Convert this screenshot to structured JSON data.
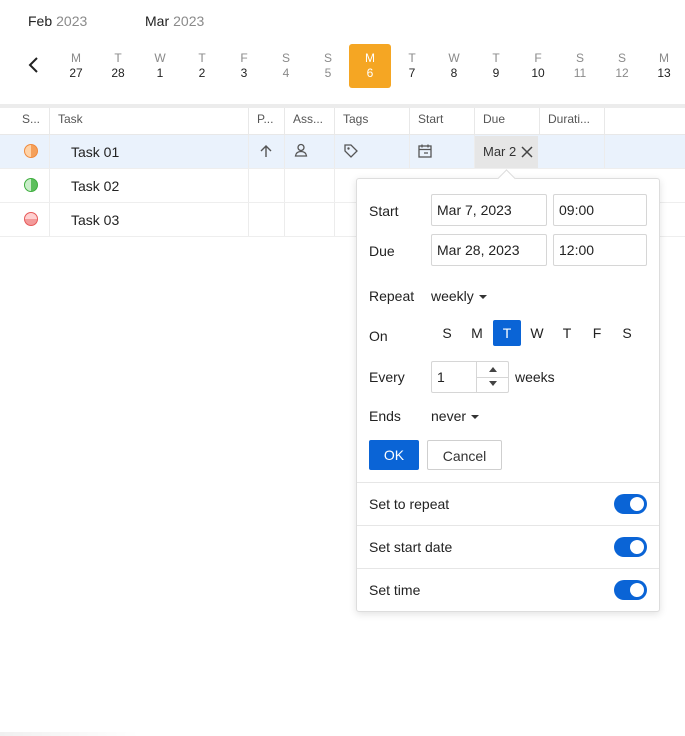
{
  "calendar": {
    "months": [
      {
        "month": "Feb",
        "year": "2023"
      },
      {
        "month": "Mar",
        "year": "2023"
      }
    ],
    "days": [
      {
        "letter": "M",
        "num": "27",
        "weekend": false,
        "today": false
      },
      {
        "letter": "T",
        "num": "28",
        "weekend": false,
        "today": false
      },
      {
        "letter": "W",
        "num": "1",
        "weekend": false,
        "today": false
      },
      {
        "letter": "T",
        "num": "2",
        "weekend": false,
        "today": false
      },
      {
        "letter": "F",
        "num": "3",
        "weekend": false,
        "today": false
      },
      {
        "letter": "S",
        "num": "4",
        "weekend": true,
        "today": false
      },
      {
        "letter": "S",
        "num": "5",
        "weekend": true,
        "today": false
      },
      {
        "letter": "M",
        "num": "6",
        "weekend": false,
        "today": true
      },
      {
        "letter": "T",
        "num": "7",
        "weekend": false,
        "today": false
      },
      {
        "letter": "W",
        "num": "8",
        "weekend": false,
        "today": false
      },
      {
        "letter": "T",
        "num": "9",
        "weekend": false,
        "today": false
      },
      {
        "letter": "F",
        "num": "10",
        "weekend": false,
        "today": false
      },
      {
        "letter": "S",
        "num": "11",
        "weekend": true,
        "today": false
      },
      {
        "letter": "S",
        "num": "12",
        "weekend": true,
        "today": false
      },
      {
        "letter": "M",
        "num": "13",
        "weekend": false,
        "today": false
      }
    ]
  },
  "grid": {
    "headers": [
      "S...",
      "Task",
      "P...",
      "Ass...",
      "Tags",
      "Start",
      "Due",
      "Durati..."
    ],
    "rows": [
      {
        "name": "Task 01",
        "status_color": "#f5a05a",
        "status_fill": "orange-half",
        "selected": true
      },
      {
        "name": "Task 02",
        "status_color": "#5cbf5c",
        "status_fill": "green-half",
        "selected": false
      },
      {
        "name": "Task 03",
        "status_color": "#f07070",
        "status_fill": "red-low",
        "selected": false
      }
    ],
    "due_value": "Mar 2"
  },
  "editor": {
    "start_label": "Start",
    "start_date": "Mar 7, 2023",
    "start_time": "09:00",
    "due_label": "Due",
    "due_date": "Mar 28, 2023",
    "due_time": "12:00",
    "repeat_label": "Repeat",
    "repeat_value": "weekly",
    "on_label": "On",
    "weekdays": [
      {
        "label": "S",
        "active": false
      },
      {
        "label": "M",
        "active": false
      },
      {
        "label": "T",
        "active": true
      },
      {
        "label": "W",
        "active": false
      },
      {
        "label": "T",
        "active": false
      },
      {
        "label": "F",
        "active": false
      },
      {
        "label": "S",
        "active": false
      }
    ],
    "every_label": "Every",
    "every_value": "1",
    "every_unit": "weeks",
    "ends_label": "Ends",
    "ends_value": "never",
    "ok_label": "OK",
    "cancel_label": "Cancel",
    "toggles": [
      {
        "label": "Set to repeat",
        "on": true
      },
      {
        "label": "Set start date",
        "on": true
      },
      {
        "label": "Set time",
        "on": true
      }
    ]
  },
  "colors": {
    "accent": "#0a64d6",
    "today": "#f5a623",
    "selected_row": "#eaf2fc"
  },
  "icons": [
    "chevron-left-icon",
    "arrow-up-icon",
    "user-icon",
    "tag-icon",
    "calendar-icon",
    "close-icon"
  ]
}
